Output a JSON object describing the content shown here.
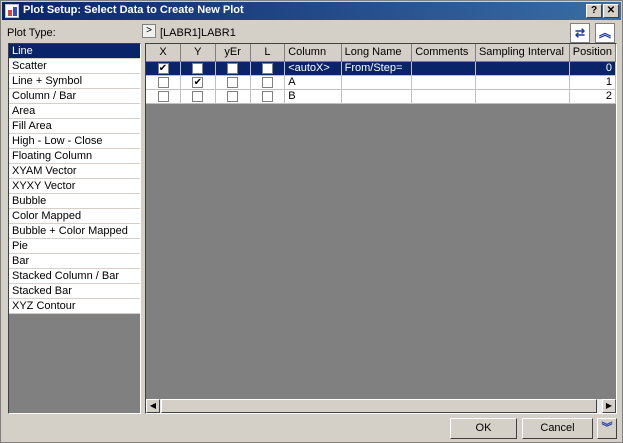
{
  "window": {
    "title": "Plot Setup: Select Data to Create New Plot"
  },
  "titlebar_buttons": {
    "help": "?",
    "close": "✕"
  },
  "plot_type_label": "Plot Type:",
  "data_source": "[LABR1]LABR1",
  "expand_symbol": ">",
  "plot_types": [
    "Line",
    "Scatter",
    "Line + Symbol",
    "Column / Bar",
    "Area",
    "Fill Area",
    "High - Low - Close",
    "Floating Column",
    "XYAM Vector",
    "XYXY Vector",
    "Bubble",
    "Color Mapped",
    "Bubble + Color Mapped",
    "Pie",
    "Bar",
    "Stacked Column / Bar",
    "Stacked Bar",
    "XYZ Contour"
  ],
  "selected_plot_type_index": 0,
  "grid": {
    "headers": [
      "X",
      "Y",
      "yEr",
      "L",
      "Column",
      "Long Name",
      "Comments",
      "Sampling Interval",
      "Position"
    ],
    "rows": [
      {
        "x": true,
        "y": false,
        "yer": false,
        "l": false,
        "column": "<autoX>",
        "long_name": "From/Step=",
        "comments": "",
        "sampling": "",
        "position": "0",
        "selected": true
      },
      {
        "x": false,
        "y": true,
        "yer": false,
        "l": false,
        "column": "A",
        "long_name": "",
        "comments": "",
        "sampling": "",
        "position": "1",
        "selected": false
      },
      {
        "x": false,
        "y": false,
        "yer": false,
        "l": false,
        "column": "B",
        "long_name": "",
        "comments": "",
        "sampling": "",
        "position": "2",
        "selected": false
      }
    ]
  },
  "buttons": {
    "ok": "OK",
    "cancel": "Cancel"
  },
  "icons": {
    "swap": "swap-arrows-icon",
    "collapse": "double-chevron-up-icon",
    "expand": "double-chevron-down-icon"
  },
  "colors": {
    "titlebar": "#0a246a",
    "selection": "#0a246a",
    "accent_icon": "#1a3aa8"
  }
}
